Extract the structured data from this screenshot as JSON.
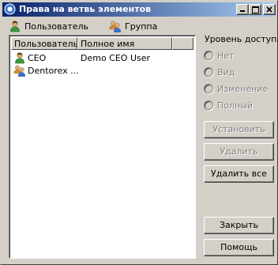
{
  "window": {
    "title": "Права на ветвь элементов",
    "title_color": "#ffffff",
    "titlebar_gradient": [
      "#0a246a",
      "#a6caf0"
    ]
  },
  "toolbar": {
    "user_label": "Пользователь",
    "group_label": "Группа"
  },
  "list": {
    "columns": [
      "Пользователь",
      "Полное имя",
      ""
    ],
    "rows": [
      {
        "name": "CEO",
        "full_name": "Demo CEO User",
        "icon": "user-icon"
      },
      {
        "name": "Dentorex ...",
        "full_name": "",
        "icon": "group-icon"
      }
    ]
  },
  "access": {
    "title": "Уровень доступа",
    "options": [
      "Нет",
      "Вид",
      "Изменение",
      "Полный"
    ],
    "selected": null
  },
  "buttons": {
    "set": "Установить",
    "delete": "Удалить",
    "delete_all": "Удалить все",
    "close": "Закрыть",
    "help": "Помощь"
  }
}
